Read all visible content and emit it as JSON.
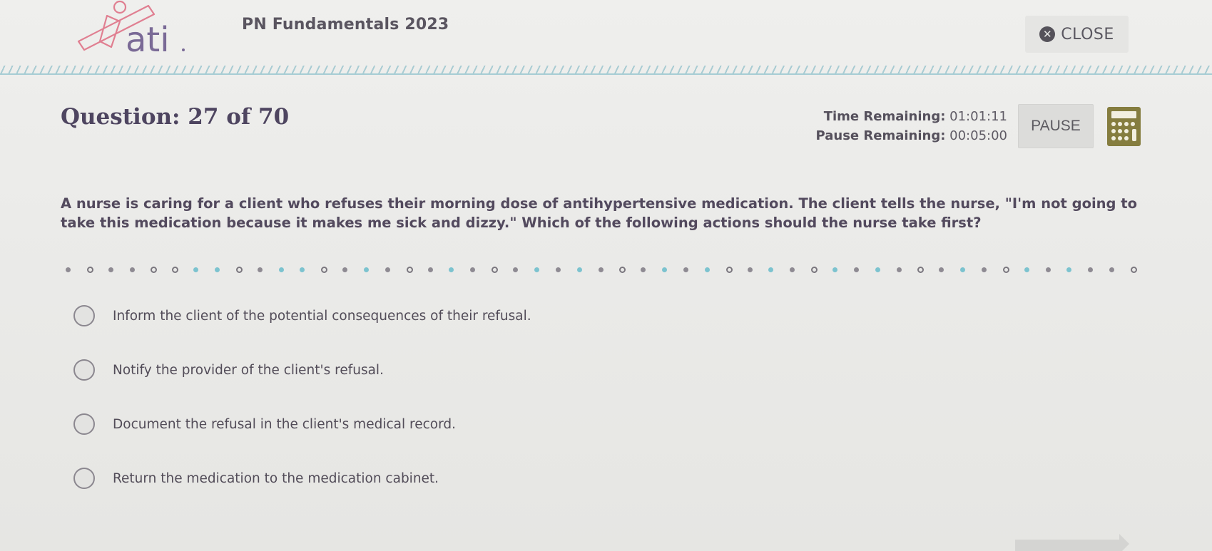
{
  "header": {
    "logo_text": "ati",
    "app_title": "PN Fundamentals 2023",
    "close_label": "CLOSE"
  },
  "question": {
    "number_label": "Question: 27 of 70",
    "current": 27,
    "total": 70,
    "stem": "A nurse is caring for a client who refuses their morning dose of antihypertensive medication. The client tells the nurse, \"I'm not going to take this medication because it makes me sick and dizzy.\" Which of the following actions should the nurse take first?"
  },
  "timers": {
    "time_remaining_label": "Time Remaining:",
    "time_remaining_value": "01:01:11",
    "pause_remaining_label": "Pause Remaining:",
    "pause_remaining_value": "00:05:00"
  },
  "toolbar": {
    "pause_label": "PAUSE",
    "calculator_icon": "calculator-icon"
  },
  "divider": {
    "pattern": "gruggrrtttgrttrgtgrgtgrtgtgrtgtrgtgrtgtgrtgtg"
  },
  "options": [
    {
      "label": "Inform the client of the potential consequences of their refusal.",
      "selected": false
    },
    {
      "label": "Notify the provider of the client's refusal.",
      "selected": false
    },
    {
      "label": "Document the refusal in the client's medical record.",
      "selected": false
    },
    {
      "label": "Return the medication to the medication cabinet.",
      "selected": false
    }
  ],
  "colors": {
    "brand_purple": "#6f5d8c",
    "logo_pink": "#e07f91",
    "accent_teal": "#7cc3cf",
    "calculator_olive": "#857d3f"
  }
}
